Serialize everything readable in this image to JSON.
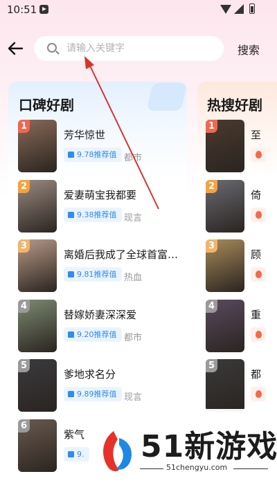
{
  "status_bar": {
    "time": "10:51"
  },
  "search": {
    "placeholder": "请输入关键字",
    "button_label": "搜索"
  },
  "lists": [
    {
      "title": "口碑好剧",
      "items": [
        {
          "rank": "1",
          "title": "芳华惊世",
          "score": "9.78推荐值",
          "tag": "都市",
          "rank_color": "#f3654e",
          "poster_color": "#8a6a58"
        },
        {
          "rank": "2",
          "title": "爱妻萌宝我都要",
          "score": "9.38推荐值",
          "tag": "现言",
          "rank_color": "#f8a23c",
          "poster_color": "#9a8a80"
        },
        {
          "rank": "3",
          "title": "离婚后我成了全球首富…",
          "score": "9.81推荐值",
          "tag": "热血",
          "rank_color": "#f3b46a",
          "poster_color": "#b89a86"
        },
        {
          "rank": "4",
          "title": "替嫁娇妻深深爱",
          "score": "9.20推荐值",
          "tag": "都市",
          "rank_color": "#9a9a9a",
          "poster_color": "#7c8a70"
        },
        {
          "rank": "5",
          "title": "爹地求名分",
          "score": "9.89推荐值",
          "tag": "现言",
          "rank_color": "#9a9a9a",
          "poster_color": "#3a3a3e"
        },
        {
          "rank": "6",
          "title": "紫气",
          "score": "9.",
          "tag": "",
          "rank_color": "#9a9a9a",
          "poster_color": "#6a5a4e"
        }
      ]
    },
    {
      "title": "热搜好剧",
      "items": [
        {
          "rank": "1",
          "title": "至",
          "rank_color": "#f3654e",
          "poster_color": "#4a3a2e"
        },
        {
          "rank": "2",
          "title": "倚",
          "rank_color": "#f8a23c",
          "poster_color": "#6a6a72"
        },
        {
          "rank": "3",
          "title": "顾",
          "rank_color": "#f3b46a",
          "poster_color": "#a88a5a"
        },
        {
          "rank": "4",
          "title": "重",
          "rank_color": "#9a9a9a",
          "poster_color": "#5a4a5e"
        },
        {
          "rank": "5",
          "title": "都",
          "rank_color": "#9a9a9a",
          "poster_color": "#3a3a3a"
        }
      ]
    }
  ],
  "watermark": {
    "text": "51新游戏",
    "url": "51chengyu.com"
  }
}
